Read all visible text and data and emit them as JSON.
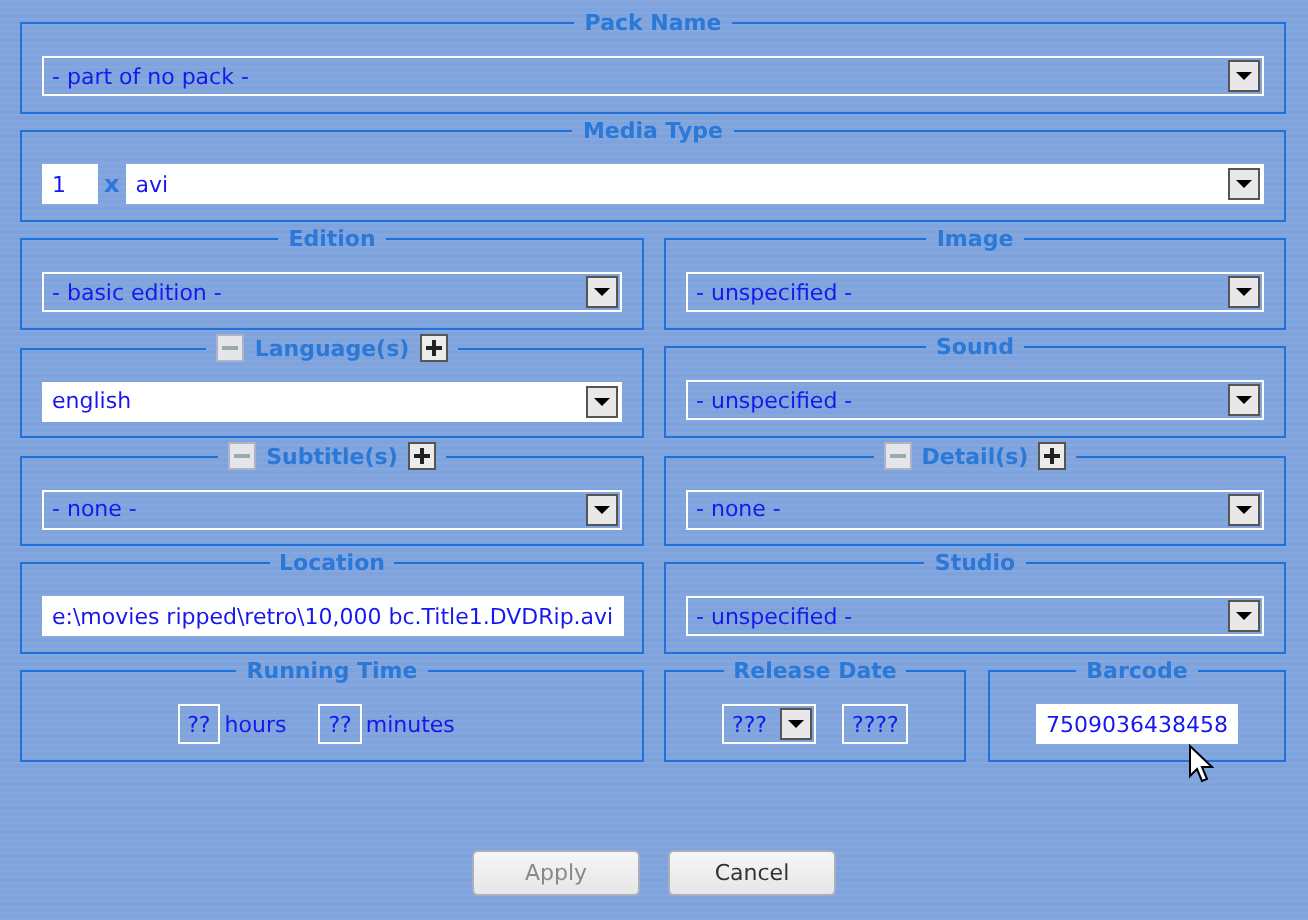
{
  "pack_name": {
    "title": "Pack Name",
    "value": "- part of no pack -",
    "set": false
  },
  "media_type": {
    "title": "Media Type",
    "count": "1",
    "times": "x",
    "value": "avi",
    "set": true
  },
  "edition": {
    "title": "Edition",
    "value": "- basic edition -",
    "set": false
  },
  "image": {
    "title": "Image",
    "value": "- unspecified -",
    "set": false
  },
  "languages": {
    "title": "Language(s)",
    "remove_disabled": true,
    "add_disabled": false,
    "value": "english",
    "set": true
  },
  "sound": {
    "title": "Sound",
    "value": "- unspecified -",
    "set": false
  },
  "subtitles": {
    "title": "Subtitle(s)",
    "remove_disabled": true,
    "add_disabled": false,
    "value": "- none -",
    "set": false
  },
  "details": {
    "title": "Detail(s)",
    "remove_disabled": true,
    "add_disabled": false,
    "value": "- none -",
    "set": false
  },
  "location": {
    "title": "Location",
    "value": "e:\\movies ripped\\retro\\10,000 bc.Title1.DVDRip.avi"
  },
  "studio": {
    "title": "Studio",
    "value": "- unspecified -",
    "set": false
  },
  "running_time": {
    "title": "Running Time",
    "hours": "??",
    "hours_label": "hours",
    "minutes": "??",
    "minutes_label": "minutes"
  },
  "release_date": {
    "title": "Release Date",
    "month": "???",
    "year": "????"
  },
  "barcode": {
    "title": "Barcode",
    "value": "7509036438458"
  },
  "buttons": [
    {
      "label": "Apply",
      "disabled": true
    },
    {
      "label": "Cancel",
      "disabled": false
    }
  ]
}
